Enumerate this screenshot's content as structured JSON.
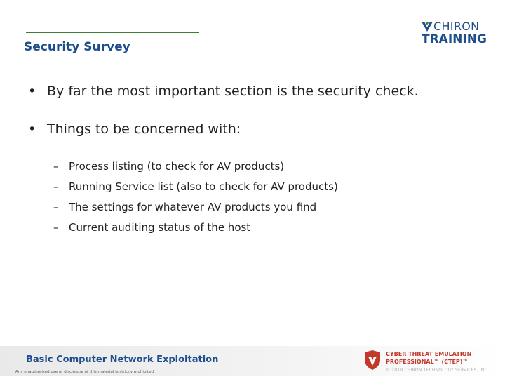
{
  "slide": {
    "title": "Security Survey"
  },
  "logo": {
    "top_text": "CHIRON",
    "bottom_text": "TRAINING",
    "icon": "chiron-shield-icon"
  },
  "bullets": [
    {
      "marker": "•",
      "text": "By far the most important section is the security check."
    },
    {
      "marker": "•",
      "text": "Things to be concerned with:"
    }
  ],
  "sub_bullets": [
    {
      "marker": "–",
      "text": "Process listing (to check for AV products)"
    },
    {
      "marker": "–",
      "text": "Running Service list (also to check for AV products)"
    },
    {
      "marker": "–",
      "text": "The settings for whatever AV products you find"
    },
    {
      "marker": "–",
      "text": "Current auditing status of the host"
    }
  ],
  "footer": {
    "course": "Basic Computer Network Exploitation",
    "notice": "Any unauthorized use or disclosure of this material is strictly prohibited.",
    "cert_line1": "CYBER THREAT EMULATION",
    "cert_line2": "PROFESSIONAL™ (CTEP)™",
    "copyright": "© 2019 CHIRON TECHNOLOGY SERVICES, INC."
  },
  "colors": {
    "title_blue": "#1f4e8c",
    "rule_green": "#3f7d36",
    "cert_red": "#c0392b"
  }
}
